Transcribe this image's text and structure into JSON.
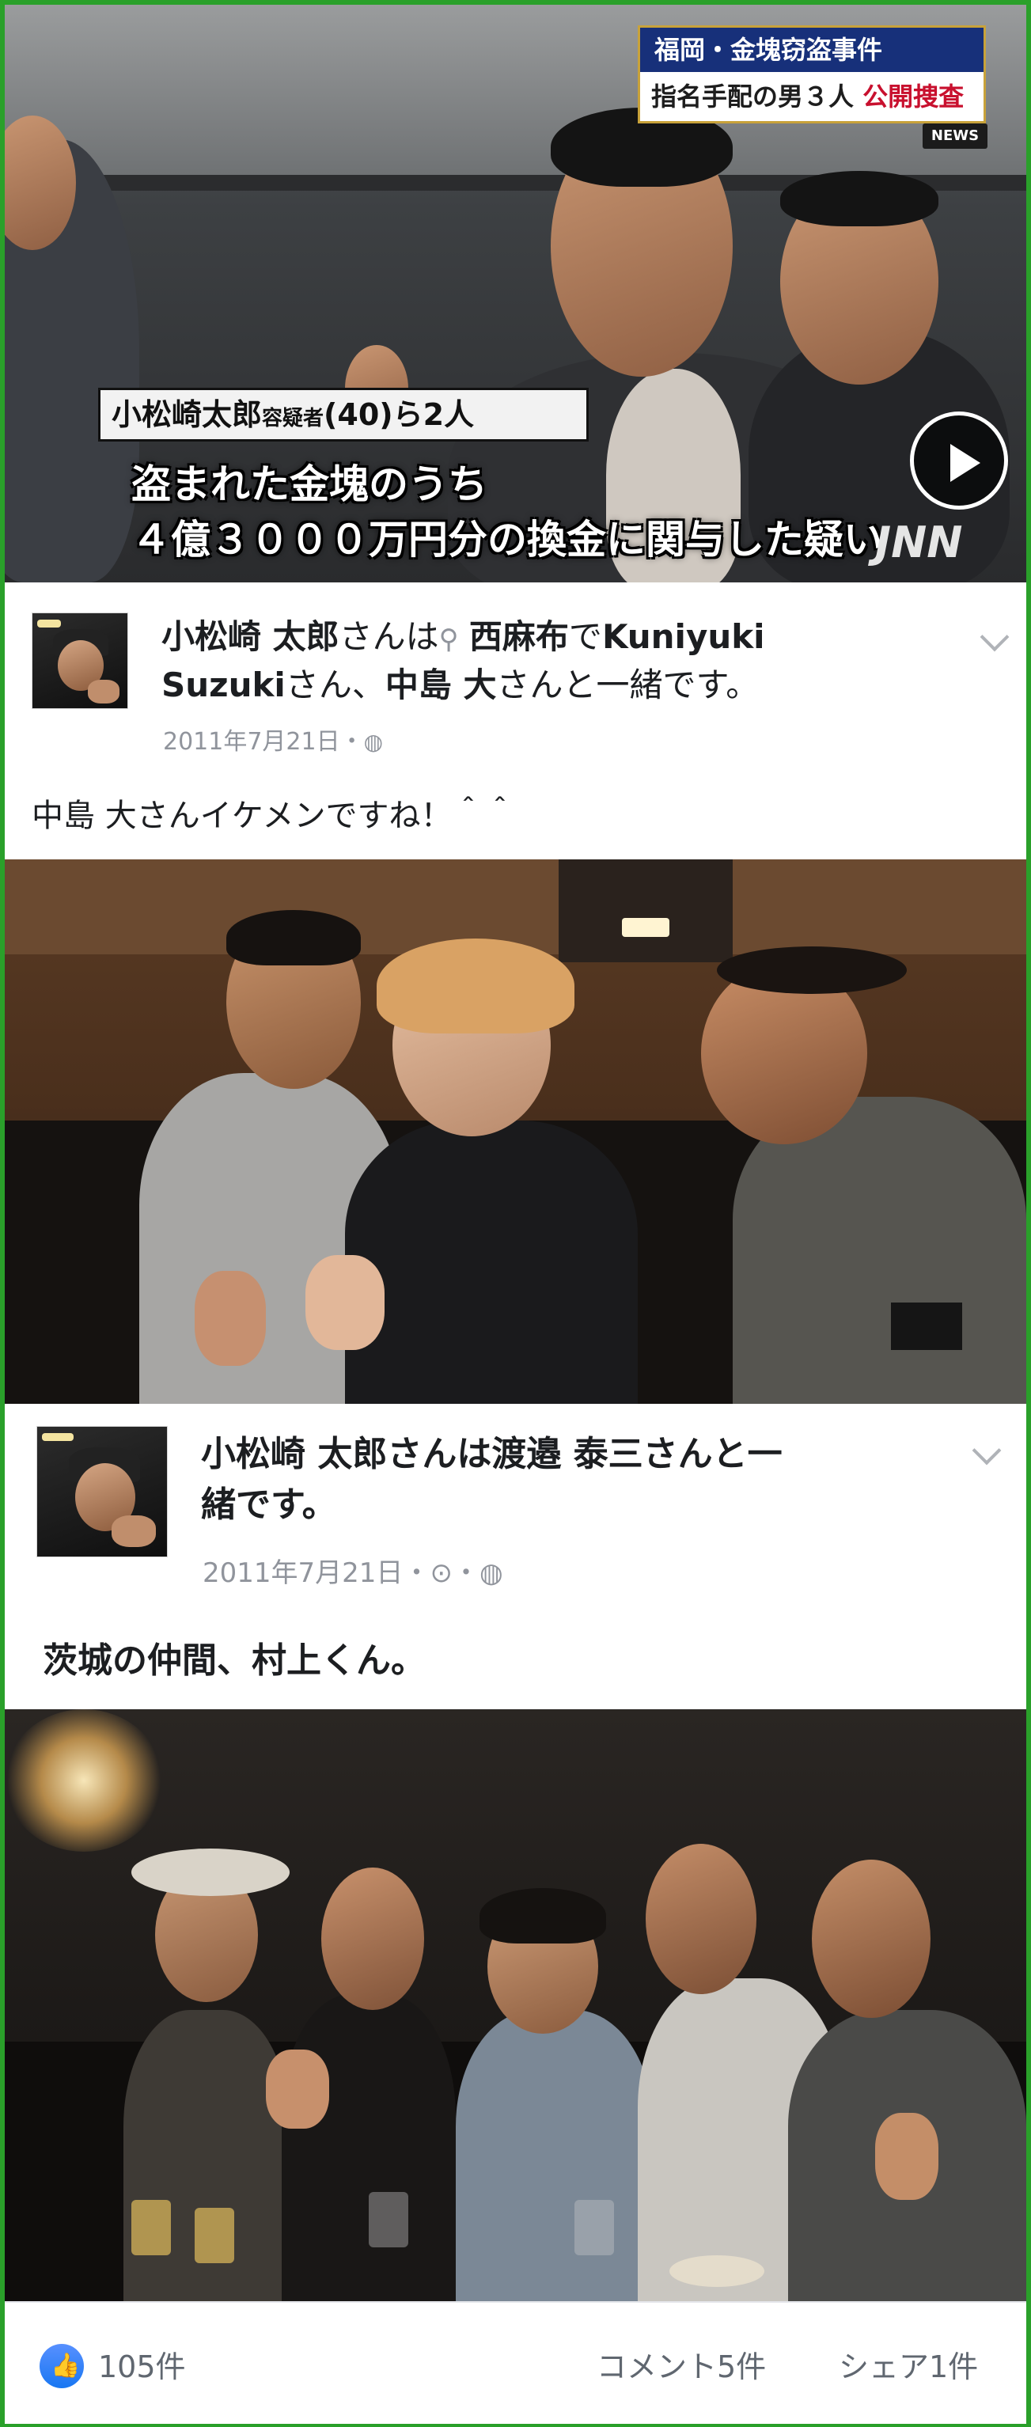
{
  "news": {
    "caption_top": "福岡・金塊窃盗事件",
    "caption_bottom_main": "指名手配の男３人",
    "caption_bottom_red": "公開捜査",
    "logo": "NEWS",
    "tag_name": "小松崎太郎",
    "tag_suffix_small": "容疑者",
    "tag_rest": "(40)ら2人",
    "subtitle_line1": "盗まれた金塊のうち",
    "subtitle_line2": "４億３０００万円分の換金に関与した疑い",
    "watermark": "JNN",
    "play_icon": "play-icon"
  },
  "post1": {
    "author": "小松崎 太郎",
    "text_is": "さんは",
    "location_icon": "location-pin-icon",
    "location": "西麻布",
    "text_de": "で",
    "with1": "Kuniyuki",
    "with2": "Suzuki",
    "text_san": "さん、",
    "with3": "中島 大",
    "text_end": "さんと一緒です。",
    "date": "2011年7月21日",
    "date_sep": "・",
    "body": "中島 大さんイケメンですね！＾＾"
  },
  "post2": {
    "author": "小松崎 太郎",
    "text_is": "さんは",
    "with1": "渡邉 泰三",
    "text_end": "さんと一",
    "text_end2": "緒です。",
    "date": "2011年7月21日",
    "date_sep": "・",
    "privacy_icon": "globe-icon",
    "body": "茨城の仲間、村上くん。"
  },
  "footer": {
    "like_icon": "thumbs-up-icon",
    "likes": "105件",
    "comments": "コメント5件",
    "shares": "シェア1件"
  },
  "colors": {
    "frame": "#2aa02a",
    "facebook_blue": "#1877f2",
    "news_navy": "#17307a",
    "news_red": "#c8102e"
  }
}
